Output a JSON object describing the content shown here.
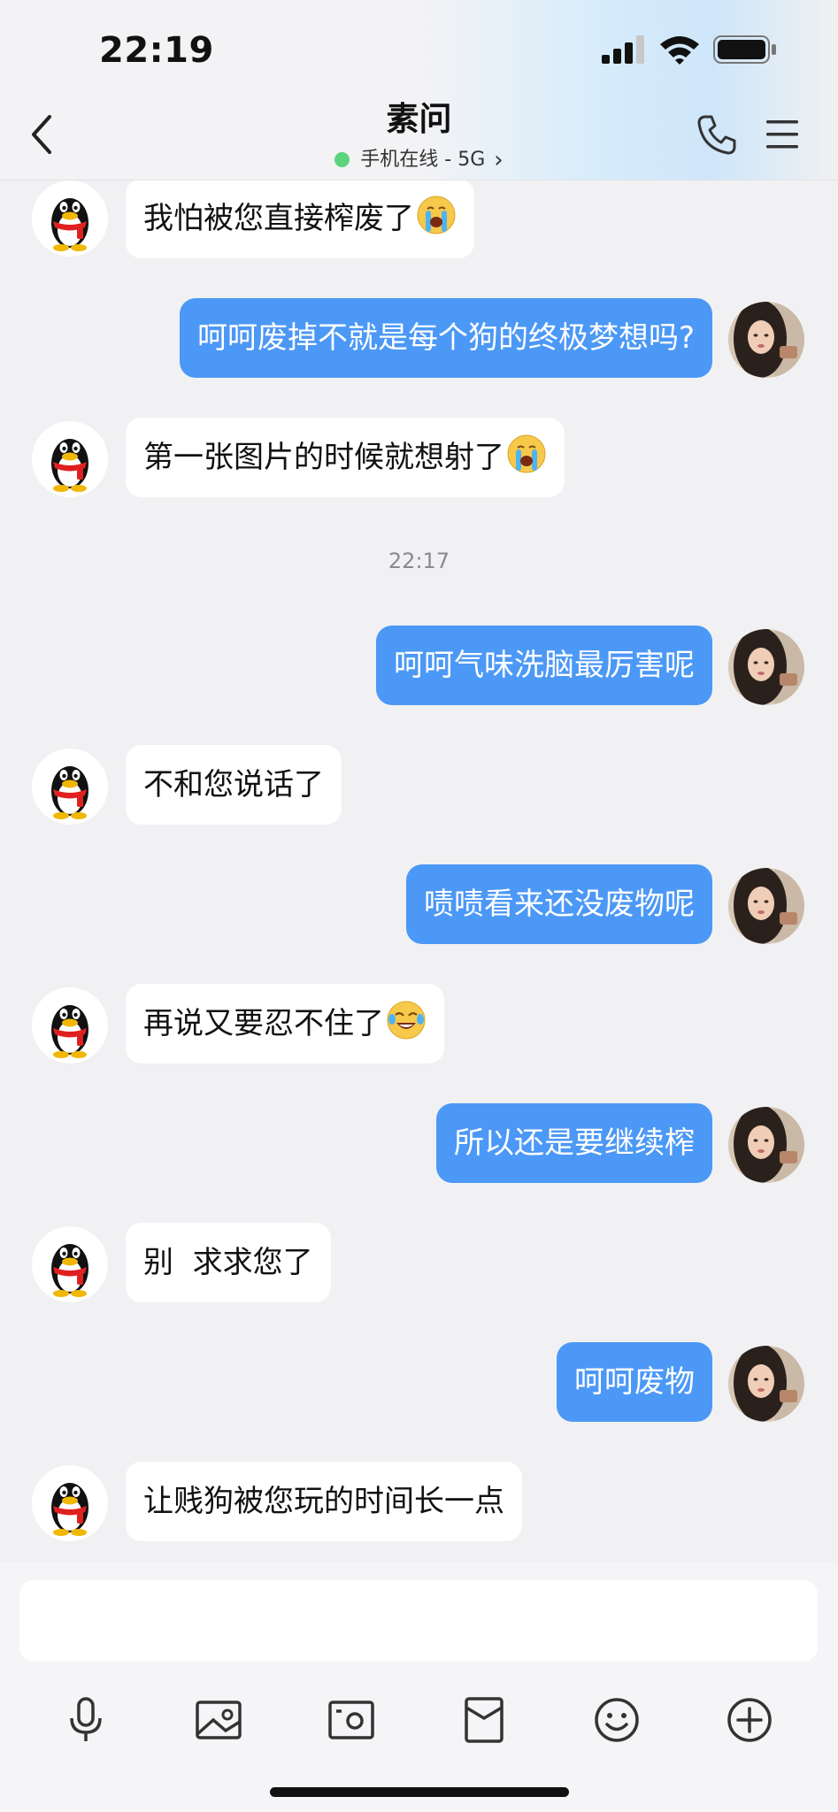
{
  "status_bar": {
    "time": "22:19"
  },
  "header": {
    "title": "素问",
    "status_text": "手机在线 - 5G",
    "chevron": "›",
    "icons": [
      "back-icon",
      "phone-icon",
      "menu-icon"
    ],
    "gradient_accent": "#d6ecfb"
  },
  "chat": {
    "timestamp": "22:17",
    "colors": {
      "incoming_bubble": "#ffffff",
      "outgoing_bubble": "#4c98f6",
      "background": "#f1f1f3"
    },
    "messages": [
      {
        "side": "in",
        "text": "我怕被您直接榨废了",
        "emoji": "loudly-crying-face"
      },
      {
        "side": "out",
        "text": "呵呵废掉不就是每个狗的终极梦想吗?"
      },
      {
        "side": "in",
        "text": "第一张图片的时候就想射了",
        "emoji": "loudly-crying-face"
      },
      {
        "side": "out",
        "text": "呵呵气味洗脑最厉害呢"
      },
      {
        "side": "in",
        "text": "不和您说话了"
      },
      {
        "side": "out",
        "text": "啧啧看来还没废物呢"
      },
      {
        "side": "in",
        "text": "再说又要忍不住了",
        "emoji": "face-with-tears-of-joy"
      },
      {
        "side": "out",
        "text": "所以还是要继续榨"
      },
      {
        "side": "in",
        "text": "别  求求您了"
      },
      {
        "side": "out",
        "text": "呵呵废物"
      },
      {
        "side": "in",
        "text": "让贱狗被您玩的时间长一点"
      }
    ]
  },
  "input": {
    "placeholder": ""
  },
  "toolbar": {
    "icons": [
      "microphone-icon",
      "image-icon",
      "camera-icon",
      "red-packet-icon",
      "smiley-icon",
      "plus-icon"
    ]
  }
}
